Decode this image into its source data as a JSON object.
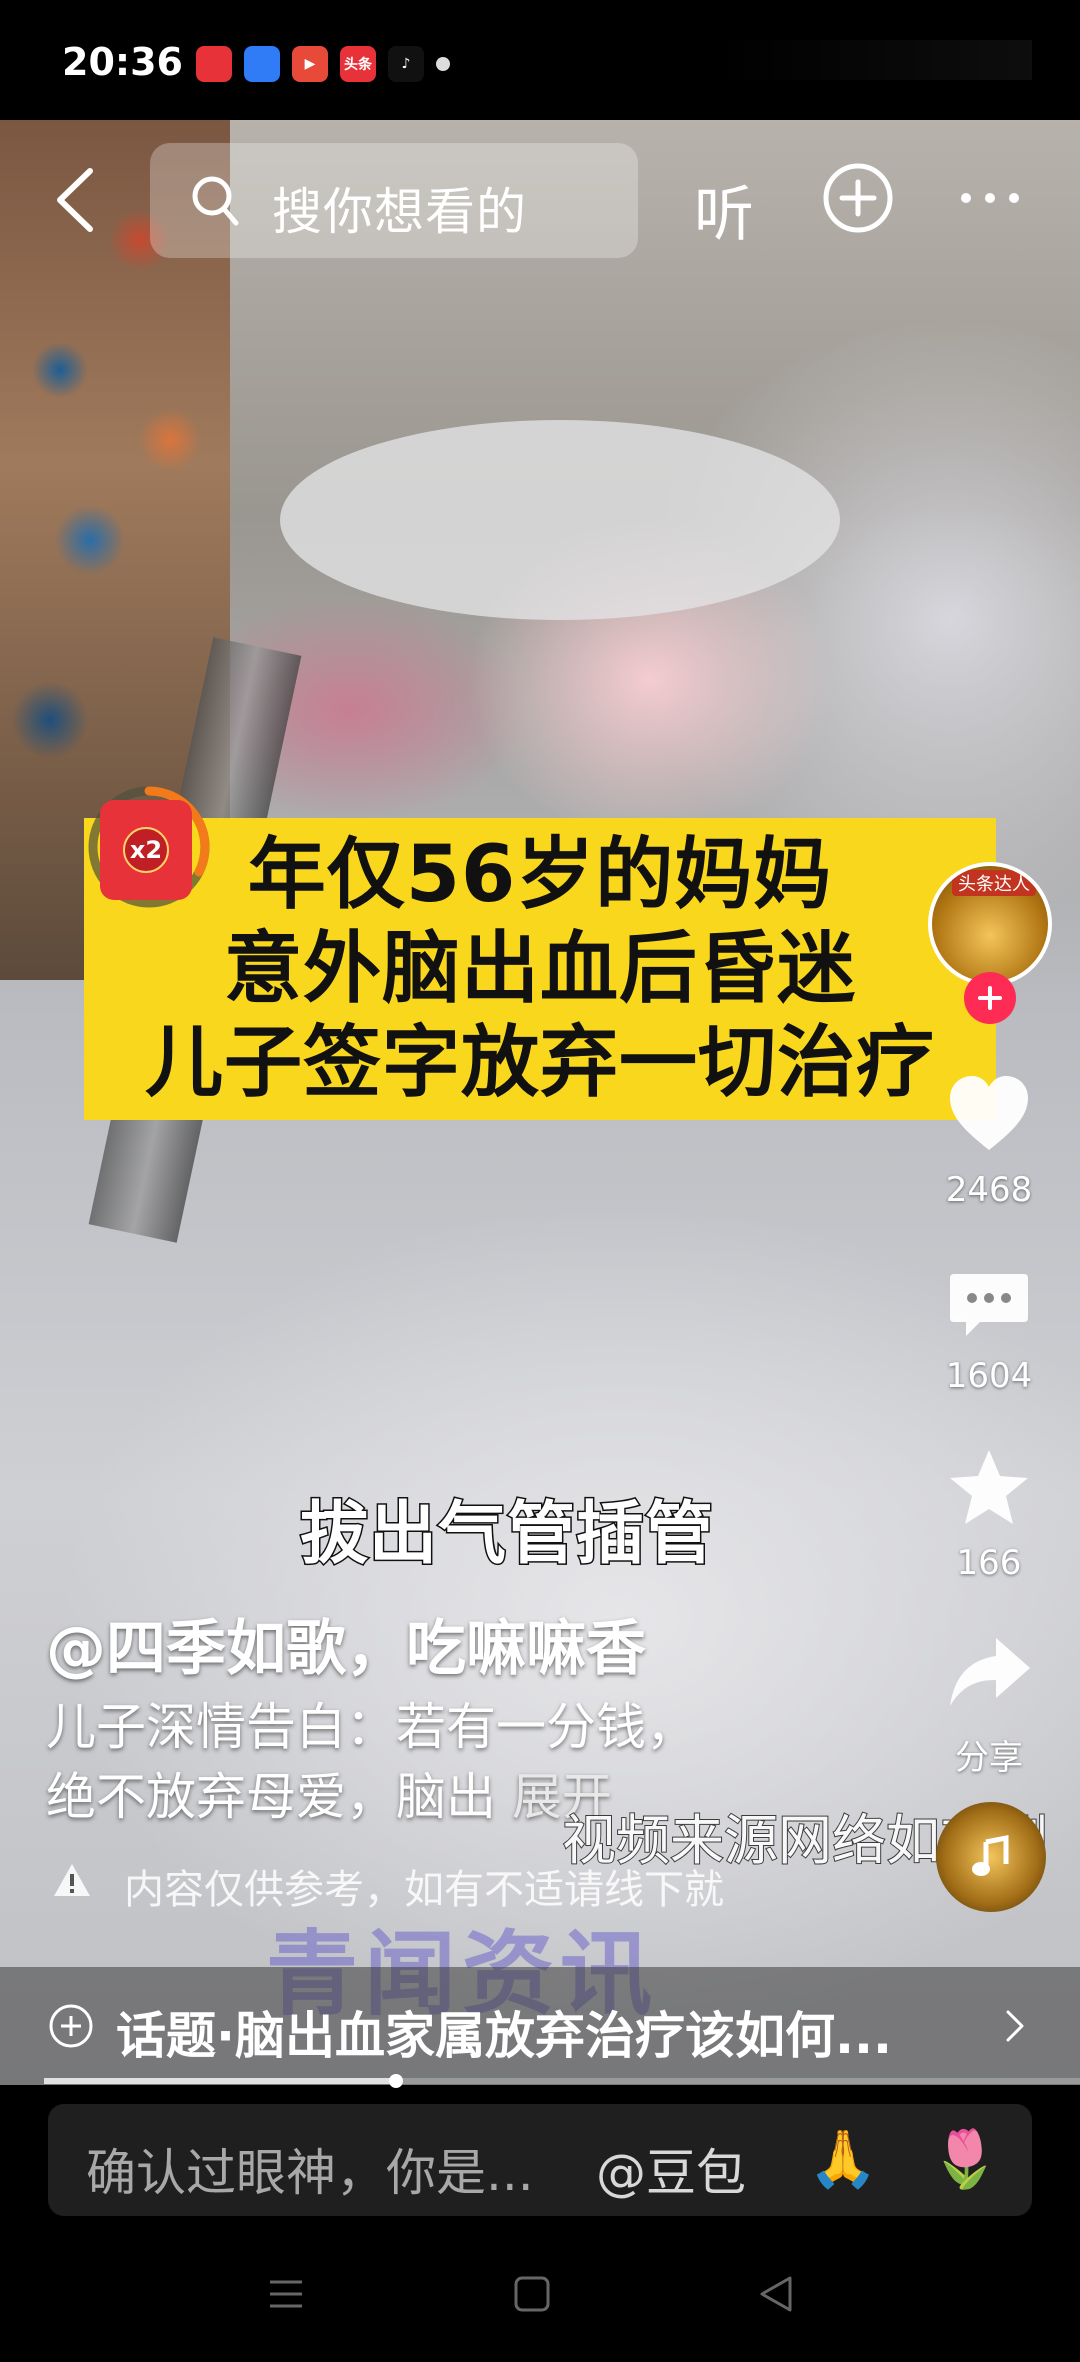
{
  "status_bar": {
    "time": "20:36",
    "apps": [
      {
        "name": "app-icon-1",
        "color": "#e8323a",
        "label": ""
      },
      {
        "name": "app-icon-2",
        "color": "#2f7cf6",
        "label": ""
      },
      {
        "name": "app-icon-3",
        "color": "#e84a3a",
        "label": "▶"
      },
      {
        "name": "app-icon-toutiao",
        "color": "#e8323a",
        "label": "头条"
      },
      {
        "name": "app-icon-tiktok",
        "color": "#111111",
        "label": "♪"
      }
    ]
  },
  "top_nav": {
    "search_placeholder": "搜你想看的",
    "listen_label": "听"
  },
  "video": {
    "title_lines": [
      "年仅56岁的妈妈",
      "意外脑出血后昏迷",
      "儿子签字放弃一切治疗"
    ],
    "red_packet_label": "x2",
    "subtitle": "拔出气管插管",
    "author": "@四季如歌，吃嘛嘛香",
    "description_line1": "儿子深情告白：若有一分钱，",
    "description_line2": "绝不放弃母爱，脑出",
    "expand_label": "展开",
    "source_note": "视频来源网络如有删",
    "warning": "内容仅供参考，如有不适请线下就",
    "watermark": "青闻资讯",
    "avatar_badge": "头条达人"
  },
  "actions": {
    "likes": "2468",
    "comments": "1604",
    "favorites": "166",
    "share_label": "分享"
  },
  "topic": {
    "text": "话题·脑出血家属放弃治疗该如何...",
    "progress": 0.34
  },
  "comment_bar": {
    "text": "确认过眼神，你是...",
    "mention": "@豆包",
    "emoji_1": "🙏",
    "emoji_2": "🌷"
  },
  "colors": {
    "banner_yellow": "#f9d71c",
    "follow_red": "#fe2c55",
    "like_white": "#ffffff"
  }
}
